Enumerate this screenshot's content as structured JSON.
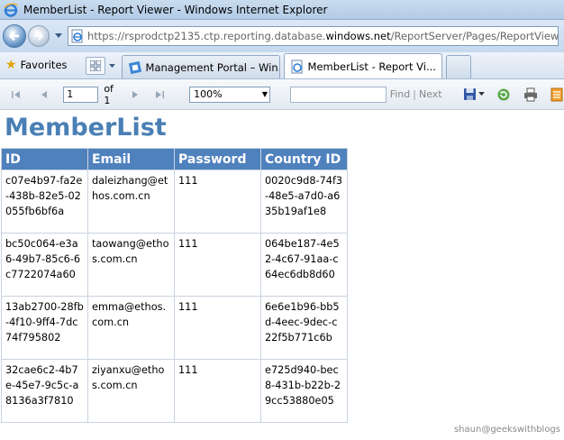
{
  "window": {
    "title": "MemberList - Report Viewer - Windows Internet Explorer"
  },
  "address_bar": {
    "url_prefix": "https://rsprodctp2135.ctp.reporting.database.",
    "url_domain": "windows.net",
    "url_suffix": "/ReportServer/Pages/ReportViewer.aspx?"
  },
  "tabs_bar": {
    "favorites_label": "Favorites",
    "tabs": [
      {
        "label": "Management Portal – Win...",
        "active": false
      },
      {
        "label": "MemberList - Report Vi...",
        "active": true
      }
    ]
  },
  "report_toolbar": {
    "page_number": "1",
    "page_of": "of 1",
    "zoom": "100%",
    "find_label": "Find",
    "next_label": "Next"
  },
  "report": {
    "title": "MemberList",
    "columns": [
      "ID",
      "Email",
      "Password",
      "Country ID"
    ],
    "rows": [
      {
        "id": "c07e4b97-fa2e-438b-82e5-02055fb6bf6a",
        "email": "daleizhang@ethos.com.cn",
        "password": "111",
        "country_id": "0020c9d8-74f3-48e5-a7d0-a635b19af1e8"
      },
      {
        "id": "bc50c064-e3a6-49b7-85c6-6c7722074a60",
        "email": "taowang@ethos.com.cn",
        "password": "111",
        "country_id": "064be187-4e52-4c67-91aa-c64ec6db8d60"
      },
      {
        "id": "13ab2700-28fb-4f10-9ff4-7dc74f795802",
        "email": "emma@ethos.com.cn",
        "password": "111",
        "country_id": "6e6e1b96-bb5d-4eec-9dec-c22f5b771c6b"
      },
      {
        "id": "32cae6c2-4b7e-45e7-9c5c-a8136a3f7810",
        "email": "ziyanxu@ethos.com.cn",
        "password": "111",
        "country_id": "e725d940-bec8-431b-b22b-29cc53880e05"
      }
    ]
  },
  "watermark": "shaun@geekswithblogs"
}
